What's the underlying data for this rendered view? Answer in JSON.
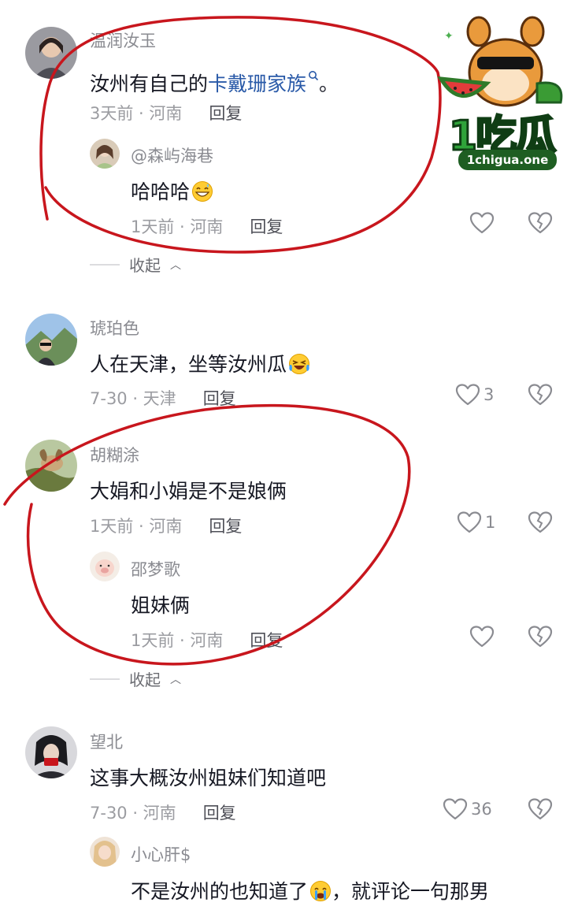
{
  "comments": [
    {
      "name": "温润汝玉",
      "text_prefix": "汝州有自己的",
      "link": "卡戴珊家族",
      "text_suffix": "。",
      "meta": "3天前 · 河南",
      "reply": "回复",
      "replies": [
        {
          "name": "@森屿海巷",
          "text": "哈哈哈",
          "meta": "1天前 · 河南",
          "reply": "回复"
        }
      ],
      "collapse": "收起"
    },
    {
      "name": "琥珀色",
      "text": "人在天津，坐等汝州瓜",
      "meta": "7-30 · 天津",
      "reply": "回复",
      "likes": "3"
    },
    {
      "name": "胡糊涂",
      "text": "大娟和小娟是不是娘俩",
      "meta": "1天前 · 河南",
      "reply": "回复",
      "likes": "1",
      "replies": [
        {
          "name": "邵梦歌",
          "text": "姐妹俩",
          "meta": "1天前 · 河南",
          "reply": "回复"
        }
      ],
      "collapse": "收起"
    },
    {
      "name": "望北",
      "text": "这事大概汝州姐妹们知道吧",
      "meta": "7-30 · 河南",
      "reply": "回复",
      "likes": "36",
      "replies": [
        {
          "name": "小心肝$",
          "text_prefix": "不是汝州的也知道了",
          "text_suffix": "，就评论一句那男"
        }
      ]
    }
  ],
  "watermark": {
    "brand": "1吃瓜",
    "site": "1chigua.one"
  },
  "icons": [
    "search-icon",
    "heart-icon",
    "dislike-icon",
    "chevron-up-icon",
    "grin-emoji-icon",
    "laugh-cry-emoji-icon",
    "cry-emoji-icon"
  ],
  "colors": {
    "annotation": "#c8161d",
    "link": "#2a5aa8",
    "watermark_green": "#2fa33a"
  }
}
